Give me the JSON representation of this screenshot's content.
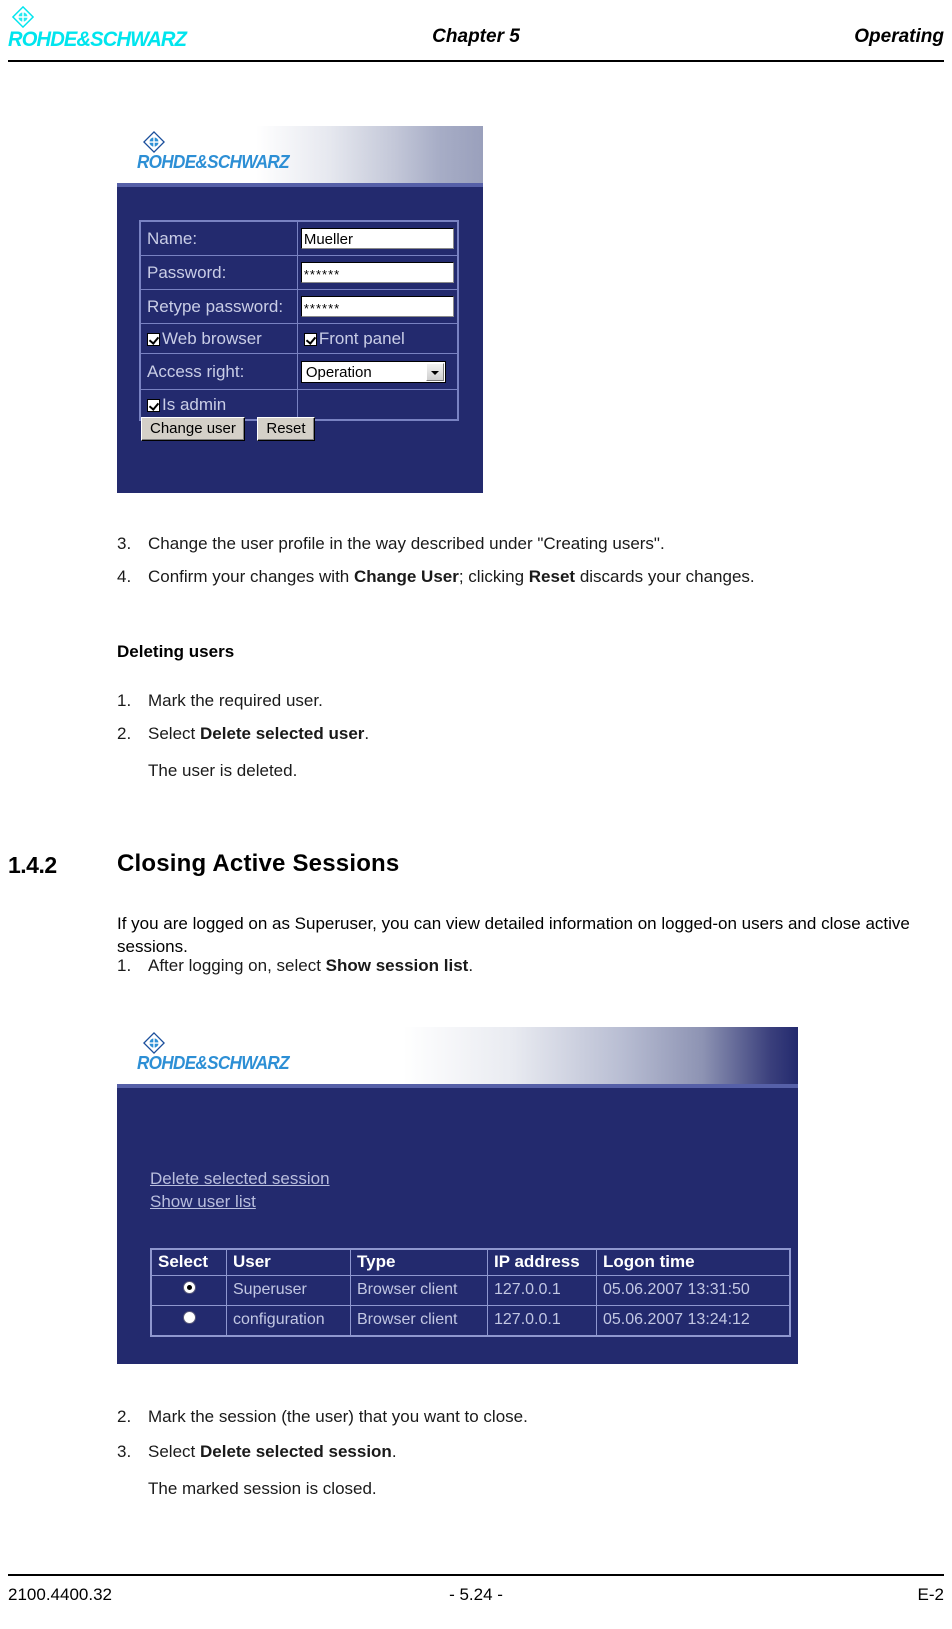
{
  "header": {
    "logo_wordmark": "ROHDE&SCHWARZ",
    "chapter": "Chapter 5",
    "section": "Operating"
  },
  "figure_user_form": {
    "banner_wordmark": "ROHDE&SCHWARZ",
    "fields": [
      {
        "label": "Name:",
        "value": "Mueller",
        "type": "text"
      },
      {
        "label": "Password:",
        "value": "******",
        "type": "password"
      },
      {
        "label": "Retype password:",
        "value": "******",
        "type": "password"
      }
    ],
    "checkbox_web_browser": {
      "label": "Web browser",
      "checked": true
    },
    "checkbox_front_panel": {
      "label": "Front panel",
      "checked": true
    },
    "access_right": {
      "label": "Access right:",
      "value": "Operation"
    },
    "checkbox_is_admin": {
      "label": "Is admin",
      "checked": true
    },
    "buttons": {
      "change_user": "Change user",
      "reset": "Reset"
    }
  },
  "steps_change_user": [
    {
      "num": "3.",
      "html": "Change the user profile in the way described under \"Creating users\"."
    },
    {
      "num": "4.",
      "html": "Confirm your changes with <b>Change User</b>; clicking <b>Reset</b> discards your changes."
    }
  ],
  "deleting_users": {
    "heading": "Deleting users",
    "steps": [
      {
        "num": "1.",
        "html": "Mark the required user."
      },
      {
        "num": "2.",
        "html": "Select <b>Delete selected user</b>."
      }
    ],
    "result": "The user is deleted."
  },
  "section": {
    "number": "1.4.2",
    "title": "Closing Active Sessions",
    "intro": "If you are logged on as Superuser, you can view detailed information on logged-on users and close active sessions."
  },
  "steps_sessions_pre": [
    {
      "num": "1.",
      "html": "After logging on, select <b>Show session list</b>."
    }
  ],
  "figure_session_list": {
    "banner_wordmark": "ROHDE&SCHWARZ",
    "links": [
      "Delete selected session",
      "Show user list"
    ],
    "table": {
      "columns": [
        "Select",
        "User",
        "Type",
        "IP address",
        "Logon time"
      ],
      "rows": [
        {
          "selected": true,
          "user": "Superuser",
          "type": "Browser client",
          "ip": "127.0.0.1",
          "logon": "05.06.2007 13:31:50"
        },
        {
          "selected": false,
          "user": "configuration",
          "type": "Browser client",
          "ip": "127.0.0.1",
          "logon": "05.06.2007 13:24:12"
        }
      ]
    }
  },
  "steps_sessions_post": [
    {
      "num": "2.",
      "html": "Mark the session (the user) that you want to close."
    },
    {
      "num": "3.",
      "html": "Select <b>Delete selected session</b>."
    }
  ],
  "sessions_result": "The marked session is closed.",
  "footer": {
    "left": "2100.4400.32",
    "center": "- 5.24 -",
    "right": "E-2"
  },
  "colors": {
    "logo_cyan": "#00e5ee",
    "logo_blue": "#2d8fd5",
    "panel_blue": "#232a6e",
    "panel_border": "#7982c2"
  }
}
